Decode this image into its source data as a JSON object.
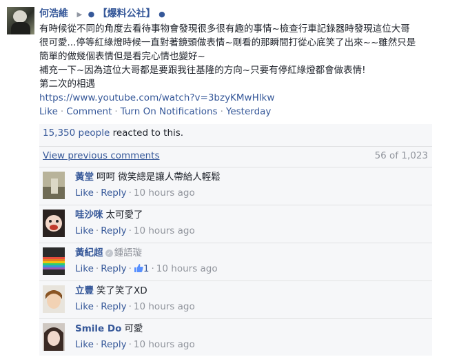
{
  "post": {
    "author": "何浩維",
    "dot": "●",
    "group": "【爆料公社】",
    "lines": [
      "有時候從不同的角度去看待事物會發現很多很有趣的事情~檢查行車記錄器時發現這位大哥",
      "很可愛...停等紅綠燈時候一直對著鏡頭做表情~剛看的那瞬間打從心底笑了出來~~雖然只是",
      "簡單的做幾個表情但是看完心情也變好~",
      "補充一下~因為這位大哥都是要跟我往基隆的方向~只要有停紅綠燈都會做表情!",
      "第二次的相遇"
    ],
    "link": "https://www.youtube.com/watch?v=3bzyKMwHlkw",
    "actions": {
      "like": "Like",
      "comment": "Comment",
      "notifications": "Turn On Notifications",
      "time": "Yesterday",
      "separator": "·"
    }
  },
  "reactions": {
    "count": "15,350 people",
    "suffix": " reacted to this."
  },
  "comments_header": {
    "view_previous": "View previous comments",
    "count": "56 of 1,023"
  },
  "comments": [
    {
      "name": "黃堂",
      "text": "呵呵 微笑總是讓人帶給人輕鬆",
      "like": "Like",
      "reply": "Reply",
      "time": "10 hours ago"
    },
    {
      "name": "哇沙咪",
      "text": "太可愛了",
      "like": "Like",
      "reply": "Reply",
      "time": "10 hours ago"
    },
    {
      "name": "黃紀超",
      "tag": "鍾語璇",
      "like": "Like",
      "reply": "Reply",
      "likes": "1",
      "time": "10 hours ago"
    },
    {
      "name": "立豐",
      "text": "笑了笑了XD",
      "like": "Like",
      "reply": "Reply",
      "time": "10 hours ago"
    },
    {
      "name": "Smile Do",
      "text": "可愛",
      "like": "Like",
      "reply": "Reply",
      "time": "10 hours ago"
    }
  ],
  "colors": {
    "link": "#365899",
    "text": "#1d2129",
    "muted": "#90949c",
    "panel": "#f6f7f9"
  }
}
